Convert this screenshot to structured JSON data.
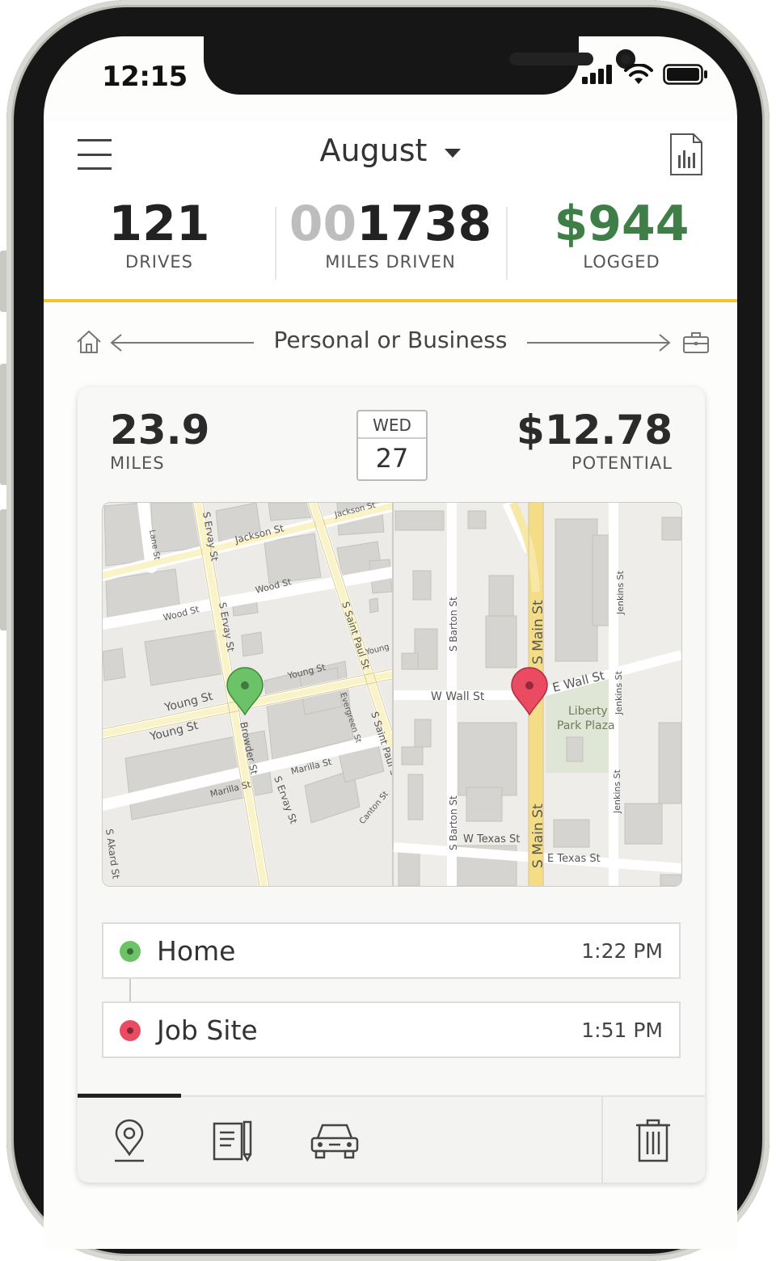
{
  "status_bar": {
    "time": "12:15"
  },
  "header": {
    "month": "August"
  },
  "stats": {
    "drives": {
      "value": "121",
      "label": "DRIVES"
    },
    "miles": {
      "value_prefix_dim": "00",
      "value": "1738",
      "label": "MILES DRIVEN"
    },
    "logged": {
      "value": "$944",
      "label": "LOGGED"
    }
  },
  "classify": {
    "label": "Personal or Business"
  },
  "drive": {
    "miles": "23.9",
    "miles_label": "MILES",
    "date_dow": "WED",
    "date_day": "27",
    "potential": "$12.78",
    "potential_label": "POTENTIAL"
  },
  "map": {
    "streets": {
      "jackson_st": "Jackson St",
      "jackson_st_small": "Jackson St",
      "lane_st": "Lane St",
      "s_ervay_st": "S Ervay St",
      "wood_st": "Wood St",
      "wood_st_2": "Wood St",
      "young_st": "Young St",
      "young_st_2": "Young St",
      "young_st_3": "Young St",
      "young_st_4": "Young",
      "browder_st": "Browder St",
      "marilla_st": "Marilla St",
      "marilla_st_2": "Marilla St",
      "s_saint_paul_st": "S Saint Paul St",
      "evergreen_st": "Evergreen St",
      "canton_st": "Canton St",
      "s_akard_st": "S Akard St",
      "s_barton_st": "S Barton St",
      "s_barton_st_2": "S Barton St",
      "s_main_st": "S Main St",
      "s_main_st_2": "S Main St",
      "w_wall_st": "W Wall St",
      "e_wall_st": "E Wall St",
      "jenkins_st": "Jenkins St",
      "jenkins_st_2": "Jenkins St",
      "jenkins_st_3": "Jenkins St",
      "w_texas_st": "W Texas St",
      "e_texas_st": "E Texas St",
      "liberty_park_plaza": "Liberty Park Plaza"
    }
  },
  "stops": [
    {
      "name": "Home",
      "time": "1:22 PM",
      "color": "#6cc267"
    },
    {
      "name": "Job Site",
      "time": "1:51 PM",
      "color": "#ea4a62"
    }
  ],
  "colors": {
    "accent": "#f1c232",
    "money": "#3f7f47",
    "start_pin": "#6cc267",
    "end_pin": "#ea4a62"
  },
  "tabs": [
    {
      "icon": "map-pin-icon",
      "active": true
    },
    {
      "icon": "notes-icon",
      "active": false
    },
    {
      "icon": "car-icon",
      "active": false
    },
    {
      "icon": "trash-icon",
      "active": false
    }
  ]
}
